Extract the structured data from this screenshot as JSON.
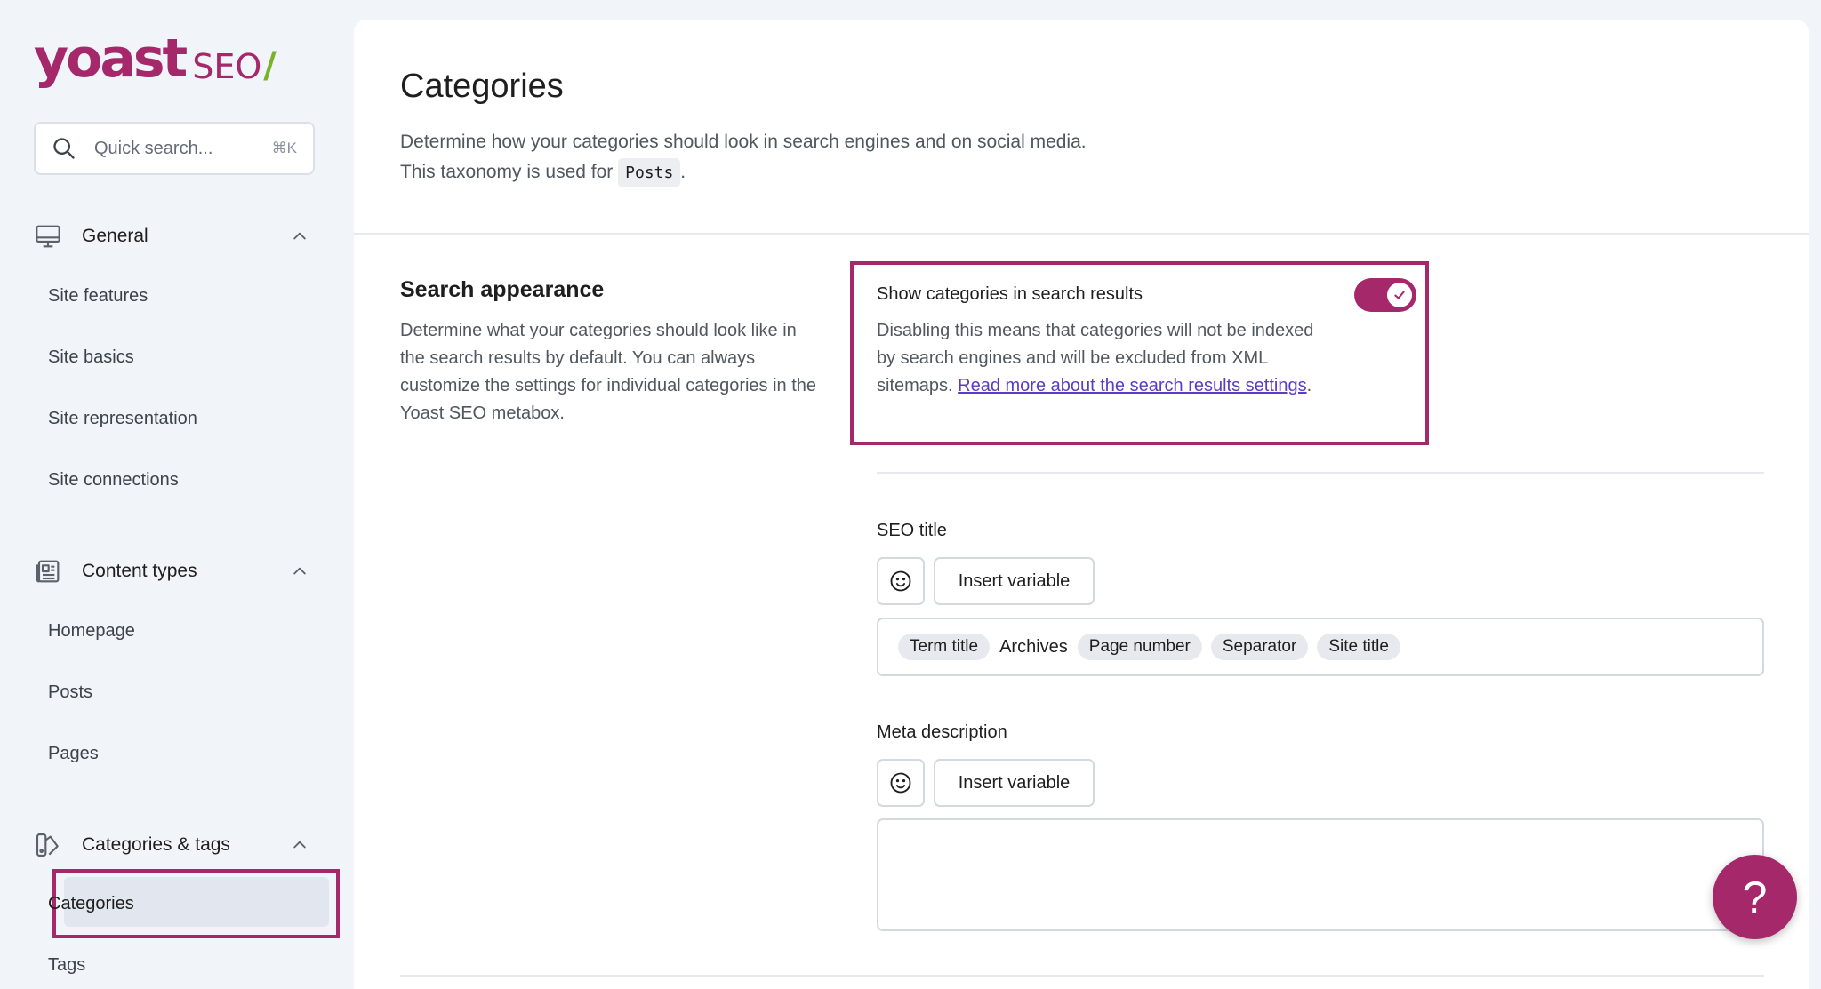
{
  "brand": {
    "logo_main": "yoast",
    "logo_suffix": "SEO",
    "logo_slash": "/",
    "primary_color": "#a4286a",
    "accent_color": "#77b227"
  },
  "search": {
    "placeholder": "Quick search...",
    "shortcut": "⌘K",
    "icon": "search-icon"
  },
  "sidebar": {
    "groups": [
      {
        "label": "General",
        "icon": "desktop-icon",
        "items": [
          "Site features",
          "Site basics",
          "Site representation",
          "Site connections"
        ]
      },
      {
        "label": "Content types",
        "icon": "content-types-icon",
        "items": [
          "Homepage",
          "Posts",
          "Pages"
        ]
      },
      {
        "label": "Categories & tags",
        "icon": "categories-tags-icon",
        "items": [
          "Categories",
          "Tags"
        ]
      }
    ],
    "active_item": "Categories"
  },
  "main": {
    "title": "Categories",
    "desc_line1": "Determine how your categories should look in search engines and on social media.",
    "desc_line2_prefix": "This taxonomy is used for",
    "desc_code": "Posts",
    "desc_line2_suffix": ".",
    "section": {
      "title": "Search appearance",
      "description": "Determine what your categories should look like in the search results by default. You can always customize the settings for individual categories in the Yoast SEO metabox."
    },
    "toggle_setting": {
      "label": "Show categories in search results",
      "description": "Disabling this means that categories will not be indexed by search engines and will be excluded from XML sitemaps.",
      "link_text": "Read more about the search results settings",
      "suffix": ".",
      "enabled": true
    },
    "seo_title": {
      "label": "SEO title",
      "insert_variable": "Insert variable",
      "tokens": [
        {
          "type": "pill",
          "text": "Term title"
        },
        {
          "type": "text",
          "text": "Archives"
        },
        {
          "type": "pill",
          "text": "Page number"
        },
        {
          "type": "pill",
          "text": "Separator"
        },
        {
          "type": "pill",
          "text": "Site title"
        }
      ]
    },
    "meta_description": {
      "label": "Meta description",
      "insert_variable": "Insert variable",
      "value": ""
    }
  },
  "help_button": {
    "label": "?"
  }
}
